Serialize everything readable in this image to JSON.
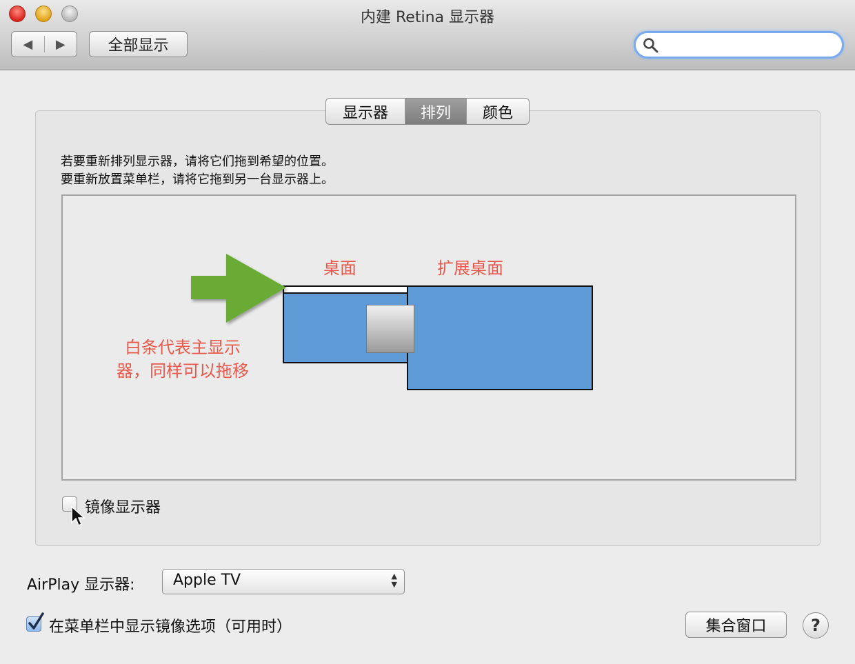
{
  "window": {
    "title": "内建 Retina 显示器",
    "show_all_label": "全部显示",
    "back_glyph": "◀",
    "forward_glyph": "▶"
  },
  "search": {
    "value": "",
    "placeholder": ""
  },
  "tabs": [
    {
      "label": "显示器",
      "active": false
    },
    {
      "label": "排列",
      "active": true
    },
    {
      "label": "颜色",
      "active": false
    }
  ],
  "instructions": {
    "line1": "若要重新排列显示器，请将它们拖到希望的位置。",
    "line2": "要重新放置菜单栏，请将它拖到另一台显示器上。"
  },
  "annotations": {
    "desktop": "桌面",
    "extended_desktop": "扩展桌面",
    "white_bar_line1": "白条代表主显示",
    "white_bar_line2": "器，同样可以拖移",
    "arrow_color": "#6aab35",
    "text_color": "#e8584a"
  },
  "mirror": {
    "label": "镜像显示器",
    "checked": false
  },
  "airplay": {
    "label": "AirPlay 显示器:",
    "value": "Apple TV"
  },
  "menubar_option": {
    "label": "在菜单栏中显示镜像选项（可用时）",
    "checked": true
  },
  "buttons": {
    "gather": "集合窗口",
    "help": "?"
  },
  "colors": {
    "display_fill": "#5f9bd6",
    "active_tab": "#888888"
  }
}
